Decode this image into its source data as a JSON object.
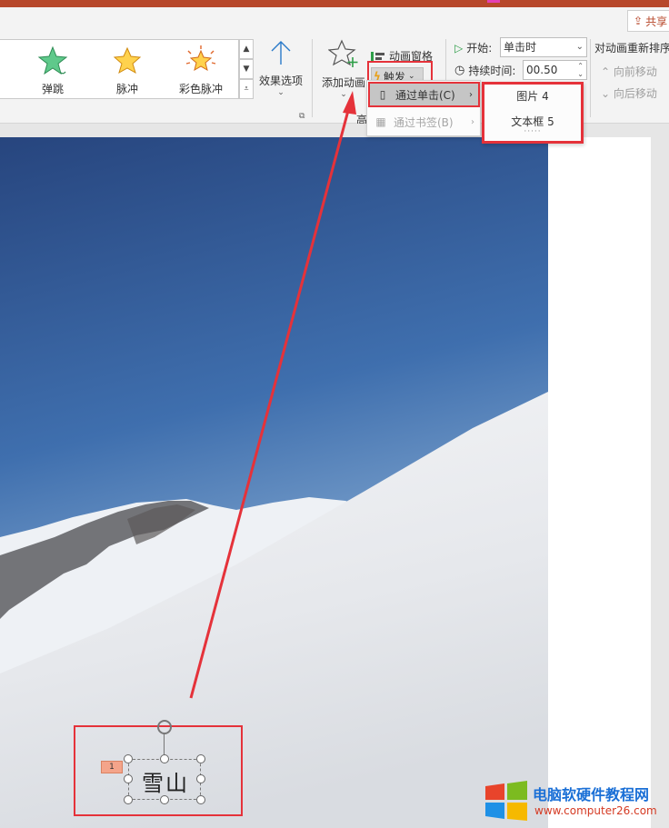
{
  "share_label": "共享",
  "animation_gallery": [
    {
      "label": "弹跳",
      "icon": "bounce-star-icon"
    },
    {
      "label": "脉冲",
      "icon": "pulse-star-icon"
    },
    {
      "label": "彩色脉冲",
      "icon": "color-pulse-star-icon"
    }
  ],
  "effect_options_label": "效果选项",
  "add_animation_label": "添加动画",
  "advanced_group_label": "高",
  "animation_pane_label": "动画窗格",
  "trigger_label": "触发",
  "timing": {
    "start_label": "开始:",
    "start_value": "单击时",
    "duration_label": "持续时间:",
    "duration_value": "00.50"
  },
  "reorder": {
    "title": "对动画重新排序",
    "move_earlier": "向前移动",
    "move_later": "向后移动"
  },
  "trigger_menu": [
    {
      "label": "通过单击(C)",
      "icon": "mouse-icon",
      "active": true
    },
    {
      "label": "通过书签(B)",
      "icon": "bookmark-icon",
      "active": false
    }
  ],
  "trigger_submenu": [
    "图片 4",
    "文本框 5"
  ],
  "submenu_more": "·····",
  "textbox": {
    "text": "雪山",
    "animation_order": "1"
  },
  "watermark": {
    "title": "电脑软硬件教程网",
    "url": "www.computer26.com"
  },
  "colors": {
    "highlight_red": "#e5323a",
    "accent": "#b7472a",
    "anim_tag": "#f4a48a"
  }
}
